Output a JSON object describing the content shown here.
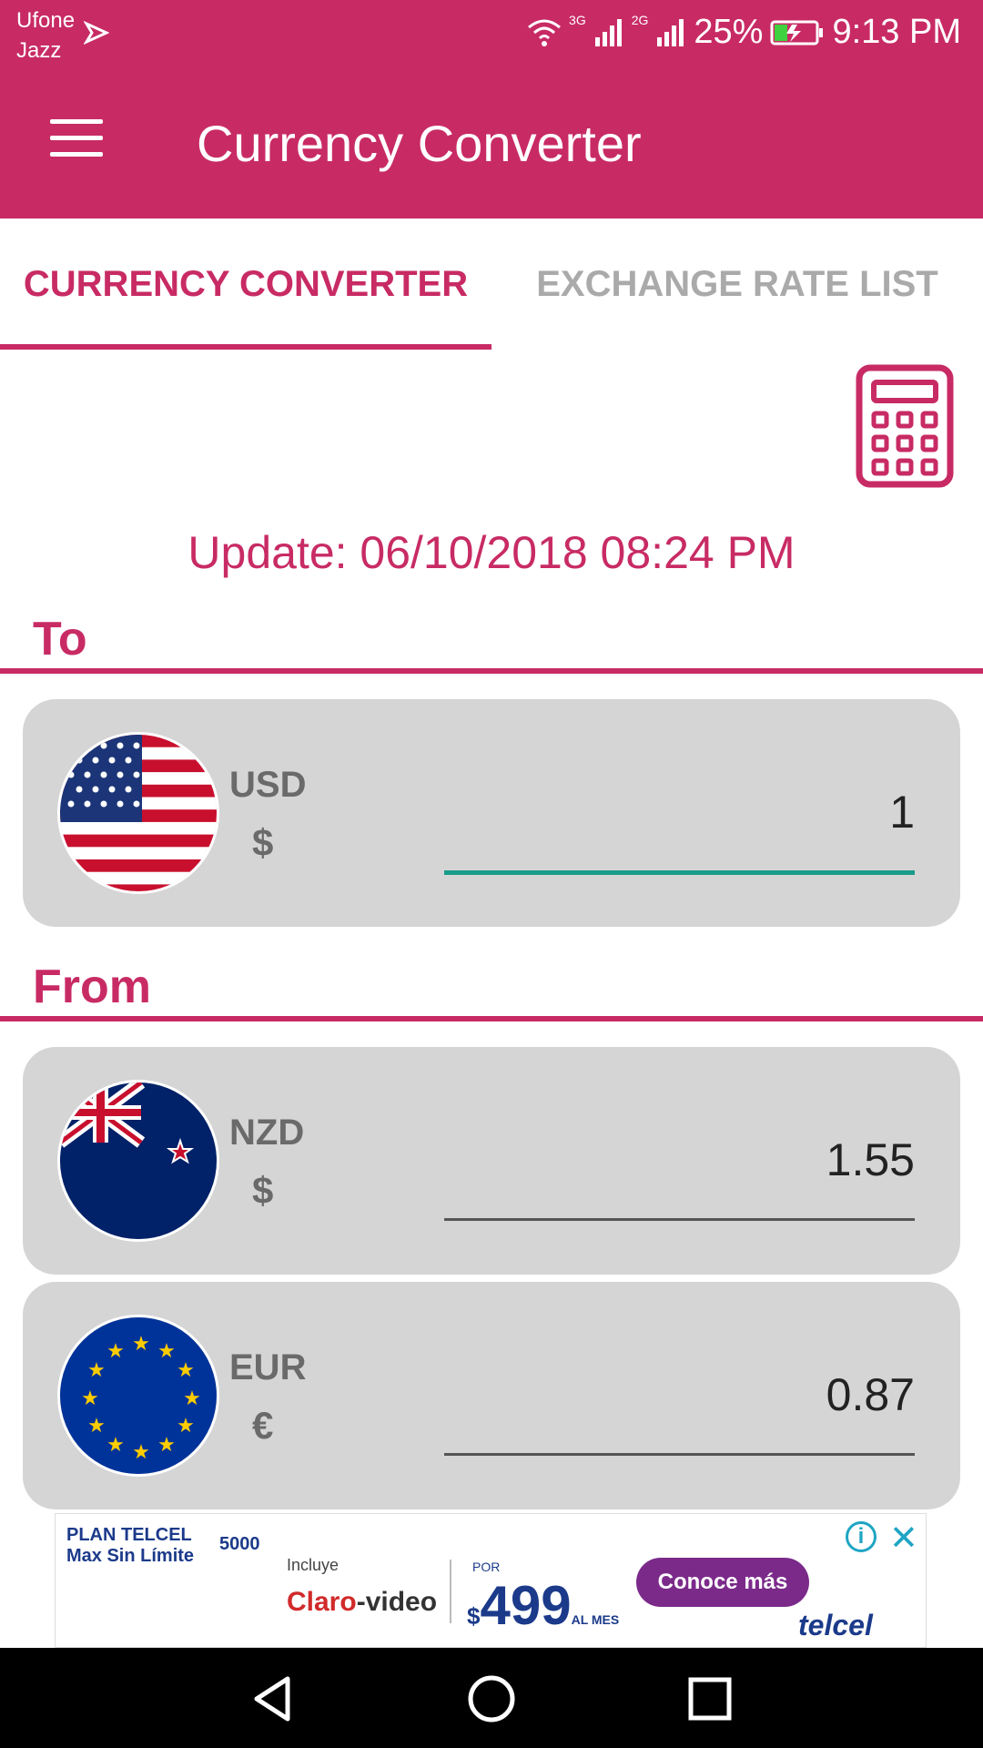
{
  "status_bar": {
    "carrier_1": "Ufone",
    "carrier_2": "Jazz",
    "network_1": "3G",
    "network_2": "2G",
    "battery": "25%",
    "time": "9:13 PM"
  },
  "app_bar": {
    "title": "Currency Converter",
    "menu_icon": "hamburger-menu-icon"
  },
  "tabs": [
    {
      "label": "CURRENCY CONVERTER",
      "active": true
    },
    {
      "label": "EXCHANGE RATE LIST",
      "active": false
    }
  ],
  "calculator_icon": "calculator-icon",
  "update_text": "Update: 06/10/2018 08:24 PM",
  "to": {
    "label": "To",
    "currency": {
      "code": "USD",
      "symbol": "$",
      "value": "1",
      "flag": "us-flag-icon"
    }
  },
  "from": {
    "label": "From",
    "currencies": [
      {
        "code": "NZD",
        "symbol": "$",
        "value": "1.55",
        "flag": "nz-flag-icon"
      },
      {
        "code": "EUR",
        "symbol": "€",
        "value": "0.87",
        "flag": "eu-flag-icon"
      }
    ]
  },
  "ad": {
    "plan_line1": "PLAN TELCEL",
    "plan_line2": "Max Sin Límite",
    "plan_number": "5000",
    "incluye": "Incluye",
    "claro_video": "Claro",
    "claro_video_suffix": "video",
    "por": "POR",
    "price": "499",
    "price_currency": "$",
    "price_suffix": "AL MES",
    "cta": "Conoce más",
    "brand": "telcel",
    "info": "i",
    "close": "✕"
  },
  "colors": {
    "primary": "#c82b64",
    "tab_inactive": "#aaaaaa",
    "card_bg": "#d5d5d5",
    "active_underline": "#1a9c8a"
  }
}
